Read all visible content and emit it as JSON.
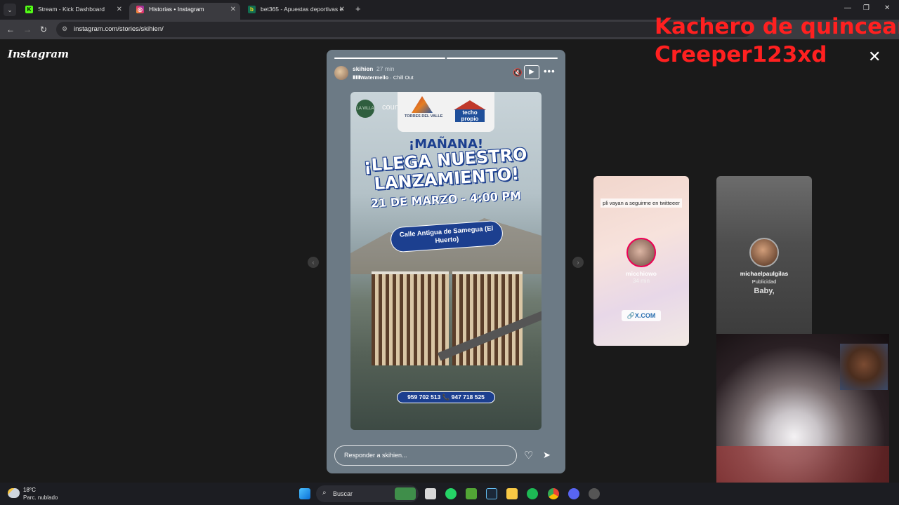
{
  "browser": {
    "tabs": [
      {
        "label": "Stream - Kick Dashboard",
        "favicon": "K"
      },
      {
        "label": "Historias • Instagram",
        "favicon": "◎"
      },
      {
        "label": "bet365 - Apuestas deportivas e",
        "favicon": "b"
      }
    ],
    "url": "instagram.com/stories/skihien/"
  },
  "instagram": {
    "logo": "Instagram",
    "story": {
      "username": "skihien",
      "time": "27 min",
      "music_artist": "Watermello",
      "music_track": "· Chill Out",
      "flyer": {
        "account": "countryclubaivilla",
        "account_badge": "LA VILLA",
        "logo_left": "TORRES DEL VALLE",
        "logo_right": "techo propio",
        "headline_small": "¡MAÑANA!",
        "headline_big": "¡LLEGA NUESTRO LANZAMIENTO!",
        "date_time": "21 DE MARZO - 4:00 PM",
        "address": "Calle Antigua de Samegua (El Huerto)",
        "phones": "959 702 513 📞 947 718 525"
      },
      "reply_placeholder": "Responder a skihien...",
      "progress": [
        1,
        1,
        0.3
      ]
    },
    "previews": [
      {
        "caption": "pli vayan a seguirme en twitteeer",
        "username": "micchiowo",
        "time": "34 min",
        "link": "🔗X.COM"
      },
      {
        "username": "michaelpaulgilas",
        "sub": "Publicidad",
        "lyric": "Baby,"
      }
    ]
  },
  "overlay": {
    "line1": "Kachero de quinceañ",
    "line2": "Creeper123xd",
    "color": "#ff2020"
  },
  "taskbar": {
    "weather_temp": "18°C",
    "weather_desc": "Parc. nublado",
    "search_label": "Buscar"
  }
}
